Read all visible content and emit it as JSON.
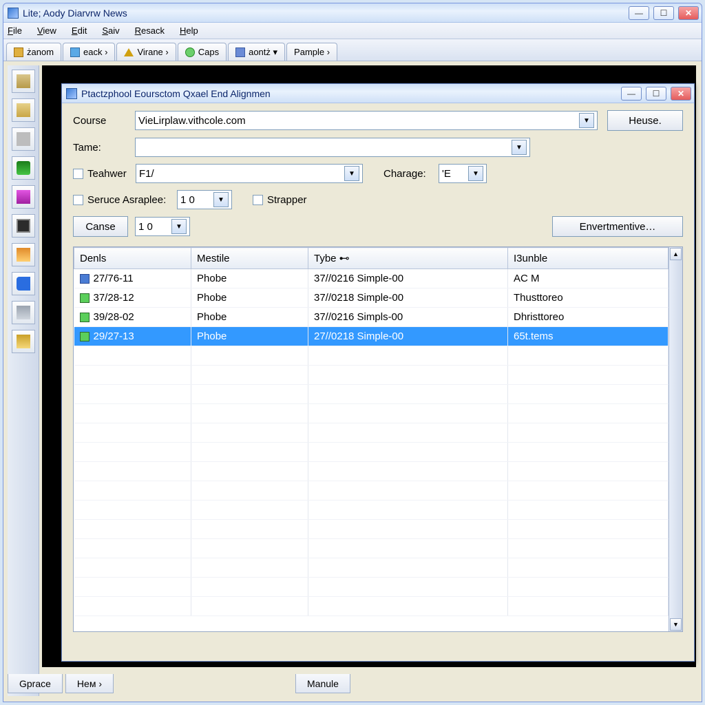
{
  "main_window": {
    "title": "Lite; Aody Diarvrw News",
    "menu": [
      "File",
      "View",
      "Edit",
      "Saiv",
      "Resack",
      "Help"
    ],
    "tabs": [
      "żanom",
      "eack ›",
      "Virane ›",
      "Caps",
      "aontż ▾",
      "Pample ›"
    ],
    "bottom_tabs": [
      "Gprace",
      "Hем ›",
      "Manule"
    ]
  },
  "dialog": {
    "title": "Ptactzphool Eoursctom Qxael End Alignmen",
    "labels": {
      "course": "Course",
      "tame": "Tame:",
      "teahwer": "Teahwer",
      "charage": "Charage:",
      "seruce": "Seruce Asraplee:",
      "strapper": "Strapper",
      "canse": "Canse"
    },
    "values": {
      "course": "VieLirplaw.vithcole.com",
      "tame": "",
      "teahwer": "F1/",
      "charage": "'E",
      "seruce": "1 0",
      "canse": "1 0"
    },
    "buttons": {
      "heuse": "Heuse.",
      "envert": "Envertmentive…"
    },
    "columns": [
      "Denls",
      "Mestile",
      "Tybe ⊷",
      "I3unble"
    ],
    "rows": [
      {
        "icon": "b",
        "c0": "27/76-11",
        "c1": "Phobe",
        "c2": "37//0216 Simple-00",
        "c3": "AC M",
        "sel": false
      },
      {
        "icon": "g",
        "c0": "37/28-12",
        "c1": "Phobe",
        "c2": "37//0218 Simple-00",
        "c3": "Thusttoreo",
        "sel": false
      },
      {
        "icon": "g",
        "c0": "39/28-02",
        "c1": "Phobe",
        "c2": "37//0216 Simpls-00",
        "c3": "Dhristtoreo",
        "sel": false
      },
      {
        "icon": "g",
        "c0": "29/27-13",
        "c1": "Phobe",
        "c2": "27//0218 Simple-00",
        "c3": "65t.tems",
        "sel": true
      }
    ]
  }
}
